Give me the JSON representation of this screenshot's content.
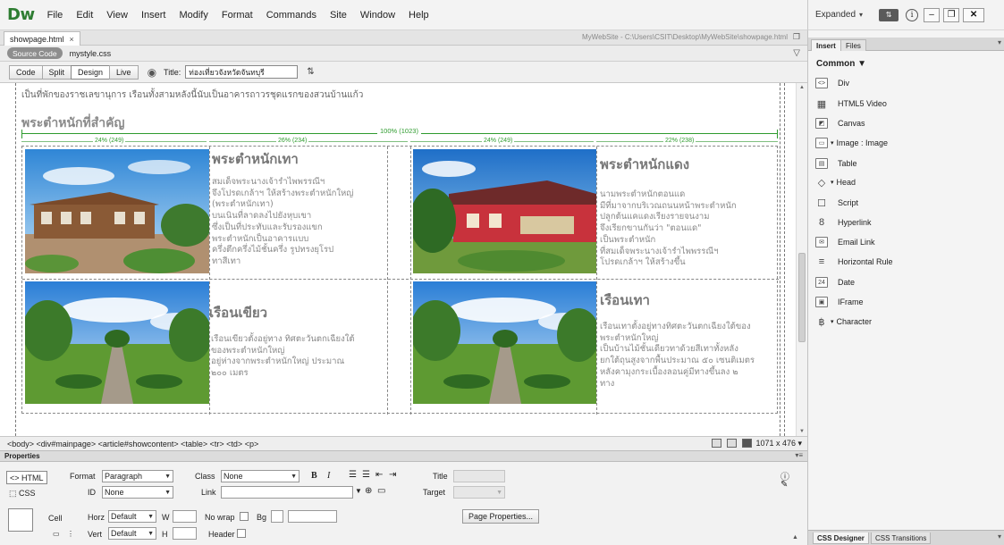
{
  "app": {
    "logo_text": "Dw",
    "menu": [
      "File",
      "Edit",
      "View",
      "Insert",
      "Modify",
      "Format",
      "Commands",
      "Site",
      "Window",
      "Help"
    ],
    "workspace": "Expanded",
    "sync_label": "⇅"
  },
  "document": {
    "tab_name": "showpage.html",
    "file_path": "MyWebSite - C:\\Users\\CSIT\\Desktop\\MyWebSite\\showpage.html",
    "source_code_label": "Source Code",
    "related_file": "mystyle.css",
    "view_buttons": [
      "Code",
      "Split",
      "Design",
      "Live"
    ],
    "title_label": "Title:",
    "title_value": "ท่องเที่ยวจังหวัดจันทบุรี"
  },
  "page": {
    "intro": "เป็นที่พักของราชเลขานุการ เรือนทั้งสามหลังนี้นับเป็นอาคารถาวรชุดแรกของสวนบ้านแก้ว",
    "section_heading": "พระตำหนักที่สำคัญ",
    "table_width_label": "100% (1023)",
    "column_widths": [
      "24% (249)",
      "26% (234)",
      "24% (249)",
      "22% (238)"
    ],
    "cells": [
      {
        "title": "พระตำหนักเทา",
        "lines": [
          "สมเด็จพระนางเจ้ารำไพพรรณีฯ",
          "จึงโปรดเกล้าฯ ให้สร้างพระตำหนักใหญ่",
          "(พระตำหนักเทา)",
          "บนเนินที่ลาดลงไปยังหุบเขา",
          "ซึ่งเป็นที่ประทับและรับรองแขก",
          "พระตำหนักเป็นอาคารแบบ",
          "ครึ่งตึกครึ่งไม้ชั้นครึ่ง รูปทรงยุโรป",
          "ทาสีเทา"
        ]
      },
      {
        "title": "พระตำหนักแดง",
        "lines": [
          "นามพระตำหนักตอนแด",
          "มีที่มาจากบริเวณถนนหน้าพระตำหนัก",
          "ปลูกต้นแคแดงเรียงรายจนงาม",
          "จึงเรียกขานกันว่า \"ตอนแด\"",
          "เป็นพระตำหนัก",
          "ที่สมเด็จพระนางเจ้ารำไพพรรณีฯ",
          "โปรดเกล้าฯ ให้สร้างขึ้น"
        ]
      },
      {
        "title": "เรือนเขียว",
        "lines": [
          "เรือนเขียวตั้งอยู่ทาง ทิศตะวันตกเฉียงใต้",
          "ของพระตำหนักใหญ่",
          "อยู่ห่างจากพระตำหนักใหญ่ ประมาณ",
          "๒๐๐ เมตร"
        ]
      },
      {
        "title": "เรือนเทา",
        "lines": [
          "เรือนเทาตั้งอยู่ทางทิศตะวันตกเฉียงใต้ของ",
          "พระตำหนักใหญ่",
          "เป็นบ้านไม้ชั้นเดียวทาด้วยสีเทาทั้งหลัง",
          "ยกใต้ถุนสูงจากพื้นประมาณ ๕๐ เซนติเมตร",
          "หลังคามุงกระเบื้องลอนคู่มีทางขึ้นลง ๒",
          "ทาง"
        ]
      }
    ]
  },
  "status": {
    "tag_path": "<body> <div#mainpage> <article#showcontent> <table> <tr> <td> <p>",
    "viewport": "1071 x 476 ▾"
  },
  "properties": {
    "title": "Properties",
    "html_label": "<> HTML",
    "css_label": "CSS",
    "format_label": "Format",
    "format_value": "Paragraph",
    "class_label": "Class",
    "class_value": "None",
    "id_label": "ID",
    "id_value": "None",
    "link_label": "Link",
    "title_label": "Title",
    "target_label": "Target",
    "bold_label": "B",
    "italic_label": "I",
    "cell_label": "Cell",
    "horz_label": "Horz",
    "horz_value": "Default",
    "vert_label": "Vert",
    "vert_value": "Default",
    "w_label": "W",
    "h_label": "H",
    "nowrap_label": "No wrap",
    "bg_label": "Bg",
    "header_label": "Header",
    "page_props_label": "Page Properties..."
  },
  "right_panel": {
    "tabs": [
      "Insert",
      "Files"
    ],
    "category": "Common",
    "items": [
      {
        "label": "Div",
        "icon": "<>"
      },
      {
        "label": "HTML5 Video",
        "icon": "▦"
      },
      {
        "label": "Canvas",
        "icon": "◩"
      },
      {
        "label": "Image : Image",
        "icon": "▭"
      },
      {
        "label": "Table",
        "icon": "▤"
      },
      {
        "label": "Head",
        "icon": "◇"
      },
      {
        "label": "Script",
        "icon": "☐"
      },
      {
        "label": "Hyperlink",
        "icon": "8"
      },
      {
        "label": "Email Link",
        "icon": "✉"
      },
      {
        "label": "Horizontal Rule",
        "icon": "≡"
      },
      {
        "label": "Date",
        "icon": "24"
      },
      {
        "label": "IFrame",
        "icon": "▣"
      },
      {
        "label": "Character",
        "icon": "฿"
      }
    ],
    "bottom_tabs": [
      "CSS Designer",
      "CSS Transitions"
    ]
  }
}
